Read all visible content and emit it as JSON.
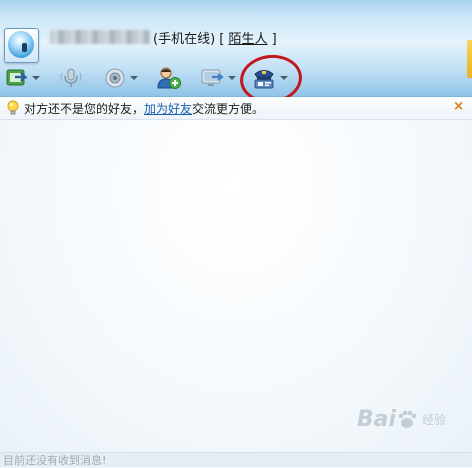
{
  "header": {
    "status": "(手机在线)",
    "bracket_open": "[",
    "bracket_close": "]",
    "stranger_label": "陌生人"
  },
  "toolbar": {
    "items": [
      {
        "icon": "send-file-icon",
        "has_dropdown": true
      },
      {
        "icon": "voice-call-icon",
        "has_dropdown": false
      },
      {
        "icon": "video-call-icon",
        "has_dropdown": true
      },
      {
        "icon": "add-contact-icon",
        "has_dropdown": false
      },
      {
        "icon": "remote-desktop-icon",
        "has_dropdown": true
      },
      {
        "icon": "police-report-icon",
        "has_dropdown": true
      }
    ]
  },
  "notice": {
    "prefix": "对方还不是您的好友，",
    "link": "加为好友",
    "suffix": "交流更方便。",
    "close": "×"
  },
  "watermark": {
    "text": "Bai",
    "suffix": "经验"
  },
  "footer": {
    "status": "目前还没有收到消息!"
  },
  "colors": {
    "annotation_circle": "#c0181c",
    "link": "#1a5fb0",
    "header_blue": "#a9d4f0"
  }
}
